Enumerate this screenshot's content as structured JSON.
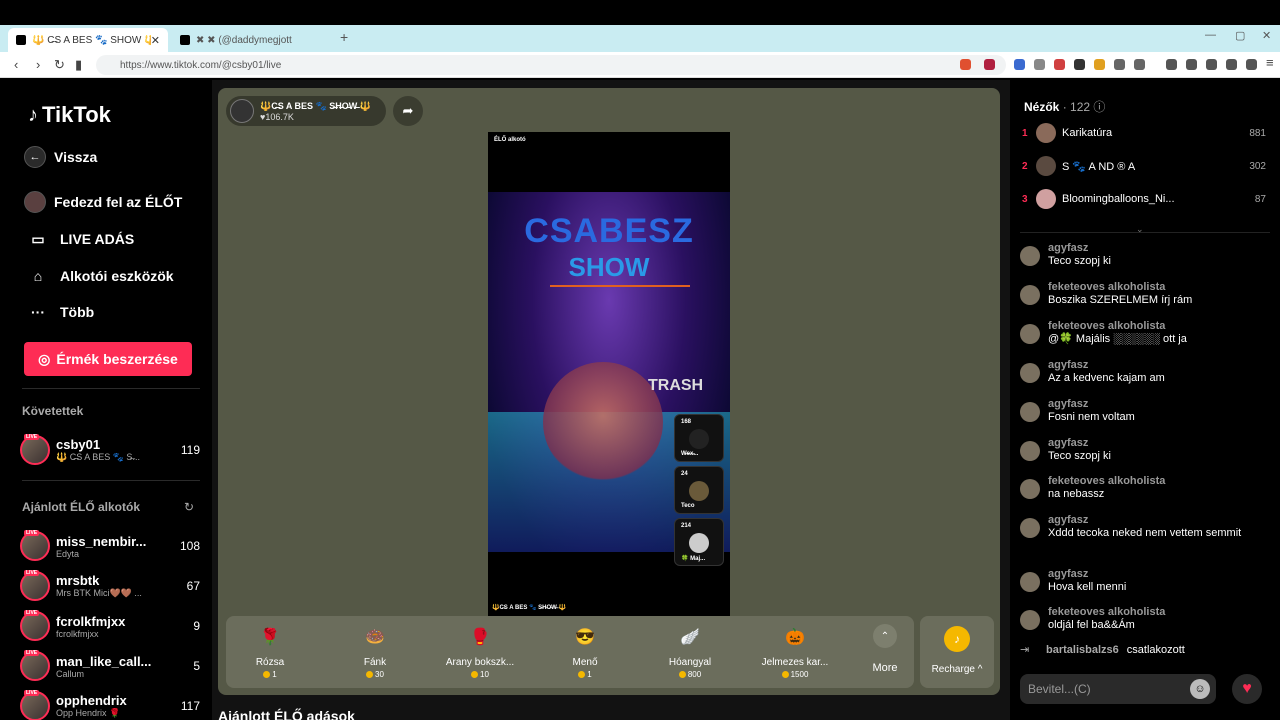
{
  "browser": {
    "tabs": [
      {
        "title": "🔱 C̶S A BES 🐾 SHOW 🔱 (@"
      },
      {
        "title": "✖ ✖ (@daddymegjott"
      }
    ],
    "url": "https://www.tiktok.com/@csby01/live"
  },
  "sidebar": {
    "logo": "TikTok",
    "back": "Vissza",
    "nav": [
      {
        "label": "Fedezd fel az ÉLŐT"
      },
      {
        "label": "LIVE ADÁS"
      },
      {
        "label": "Alkotói eszközök"
      },
      {
        "label": "Több"
      }
    ],
    "coins_button": "Érmék beszerzése",
    "followed_title": "Követettek",
    "followed": [
      {
        "name": "csby01",
        "sub": "🔱 C̶S A BES 🐾 S̶...",
        "count": "119"
      }
    ],
    "recommended_title": "Ajánlott ÉLŐ alkotók",
    "recommended": [
      {
        "name": "miss_nembir...",
        "sub": "Edyta",
        "count": "108"
      },
      {
        "name": "mrsbtk",
        "sub": "Mrs BTK Mici🤎🤎 ...",
        "count": "67"
      },
      {
        "name": "fcrolkfmjxx",
        "sub": "fcrolkfmjxx",
        "count": "9"
      },
      {
        "name": "man_like_call...",
        "sub": "Callum",
        "count": "5"
      },
      {
        "name": "opphendrix",
        "sub": "Opp Hendrix 🌹",
        "count": "117"
      }
    ],
    "live_tag": "LIVE"
  },
  "stage": {
    "host_name": "🔱C̶S A BES 🐾 S̶H̶O̶W̶ 🔱",
    "host_likes": "♥106.7K",
    "video": {
      "live_label": "ÉLŐ alkotó",
      "title_line1": "CSABESZ",
      "title_line2": "SHOW",
      "overlay_text": "TRASH",
      "bottom_name": "🔱C̶S A BES 🐾 S̶H̶O̶W̶ 🔱",
      "guests": [
        {
          "num": "168",
          "name": "W̶e̶x̶..."
        },
        {
          "num": "24",
          "name": "Teco"
        },
        {
          "num": "214",
          "name": "🍀 Maj..."
        }
      ]
    },
    "gifts": [
      {
        "name": "Rózsa",
        "price": "1",
        "icon": "🌹"
      },
      {
        "name": "Fánk",
        "price": "30",
        "icon": "🍩"
      },
      {
        "name": "Arany bokszk...",
        "price": "10",
        "icon": "🥊"
      },
      {
        "name": "Menő",
        "price": "1",
        "icon": "😎"
      },
      {
        "name": "Hóangyal",
        "price": "800",
        "icon": "🪽"
      },
      {
        "name": "Jelmezes kar...",
        "price": "1500",
        "icon": "🎃"
      }
    ],
    "more_label": "More",
    "recharge_label": "Recharge ^",
    "recommended_heading": "Ajánlott ÉLŐ adások"
  },
  "right_panel": {
    "viewers_label": "Nézők",
    "viewers_count": "· 122",
    "top_viewers": [
      {
        "rank": "1",
        "name": "Karikatúra",
        "score": "881"
      },
      {
        "rank": "2",
        "name": "S 🐾 A ND ® A",
        "score": "302"
      },
      {
        "rank": "3",
        "name": "Bloomingballoons_Ni...",
        "score": "87"
      }
    ],
    "chat": [
      {
        "user": "agyfasz",
        "msg": "Teco szopj ki"
      },
      {
        "user": "feketeoves alkoholista",
        "msg": "Boszika SZERELMEM írj rám"
      },
      {
        "user": "feketeoves alkoholista",
        "msg": "@🍀 Majális ░░░░░░ ott ja"
      },
      {
        "user": "agyfasz",
        "msg": "Az a kedvenc kajam am"
      },
      {
        "user": "agyfasz",
        "msg": "Fosni nem voltam"
      },
      {
        "user": "agyfasz",
        "msg": "Teco szopj ki"
      },
      {
        "user": "feketeoves alkoholista",
        "msg": "na nebassz"
      },
      {
        "user": "agyfasz",
        "msg": "Xddd tecoka neked nem vettem semmit"
      },
      {
        "user": "agyfasz",
        "msg": "Hova kell menni"
      },
      {
        "user": "feketeoves alkoholista",
        "msg": "oldjál fel ba&&Ám"
      }
    ],
    "joined_user": "bartalisbalzs6",
    "joined_text": "csatlakozott",
    "input_placeholder": "Bevitel...(C)"
  },
  "colors": {
    "accent": "#fe2c55",
    "stage_bg": "#555846",
    "coin": "#f5b800"
  }
}
